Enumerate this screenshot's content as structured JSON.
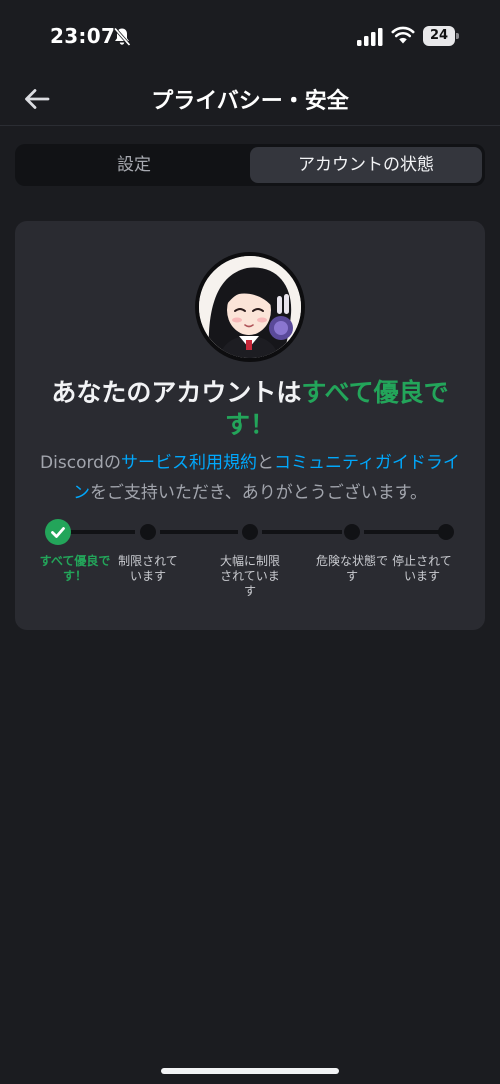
{
  "status_bar": {
    "time": "23:07",
    "battery": "24"
  },
  "header": {
    "title": "プライバシー・安全"
  },
  "tabs": [
    {
      "label": "設定",
      "active": false
    },
    {
      "label": "アカウントの状態",
      "active": true
    }
  ],
  "card": {
    "title_prefix": "あなたのアカウントは",
    "title_status": "すべて優良です！",
    "desc_1": "Discordの",
    "desc_link_1": "サービス利用規約",
    "desc_2": "と",
    "desc_link_2": "コミュニティガイドライン",
    "desc_3": "をご支持いただき、ありがとうございます。"
  },
  "steps": [
    {
      "label": "すべて優良です！",
      "current": true
    },
    {
      "label": "制限されています",
      "current": false
    },
    {
      "label": "大幅に制限されています",
      "current": false
    },
    {
      "label": "危険な状態です",
      "current": false
    },
    {
      "label": "停止されています",
      "current": false
    }
  ],
  "colors": {
    "background": "#1b1c20",
    "card": "#2a2b31",
    "success_green": "#23a55a",
    "link_blue": "#00a8fc"
  }
}
